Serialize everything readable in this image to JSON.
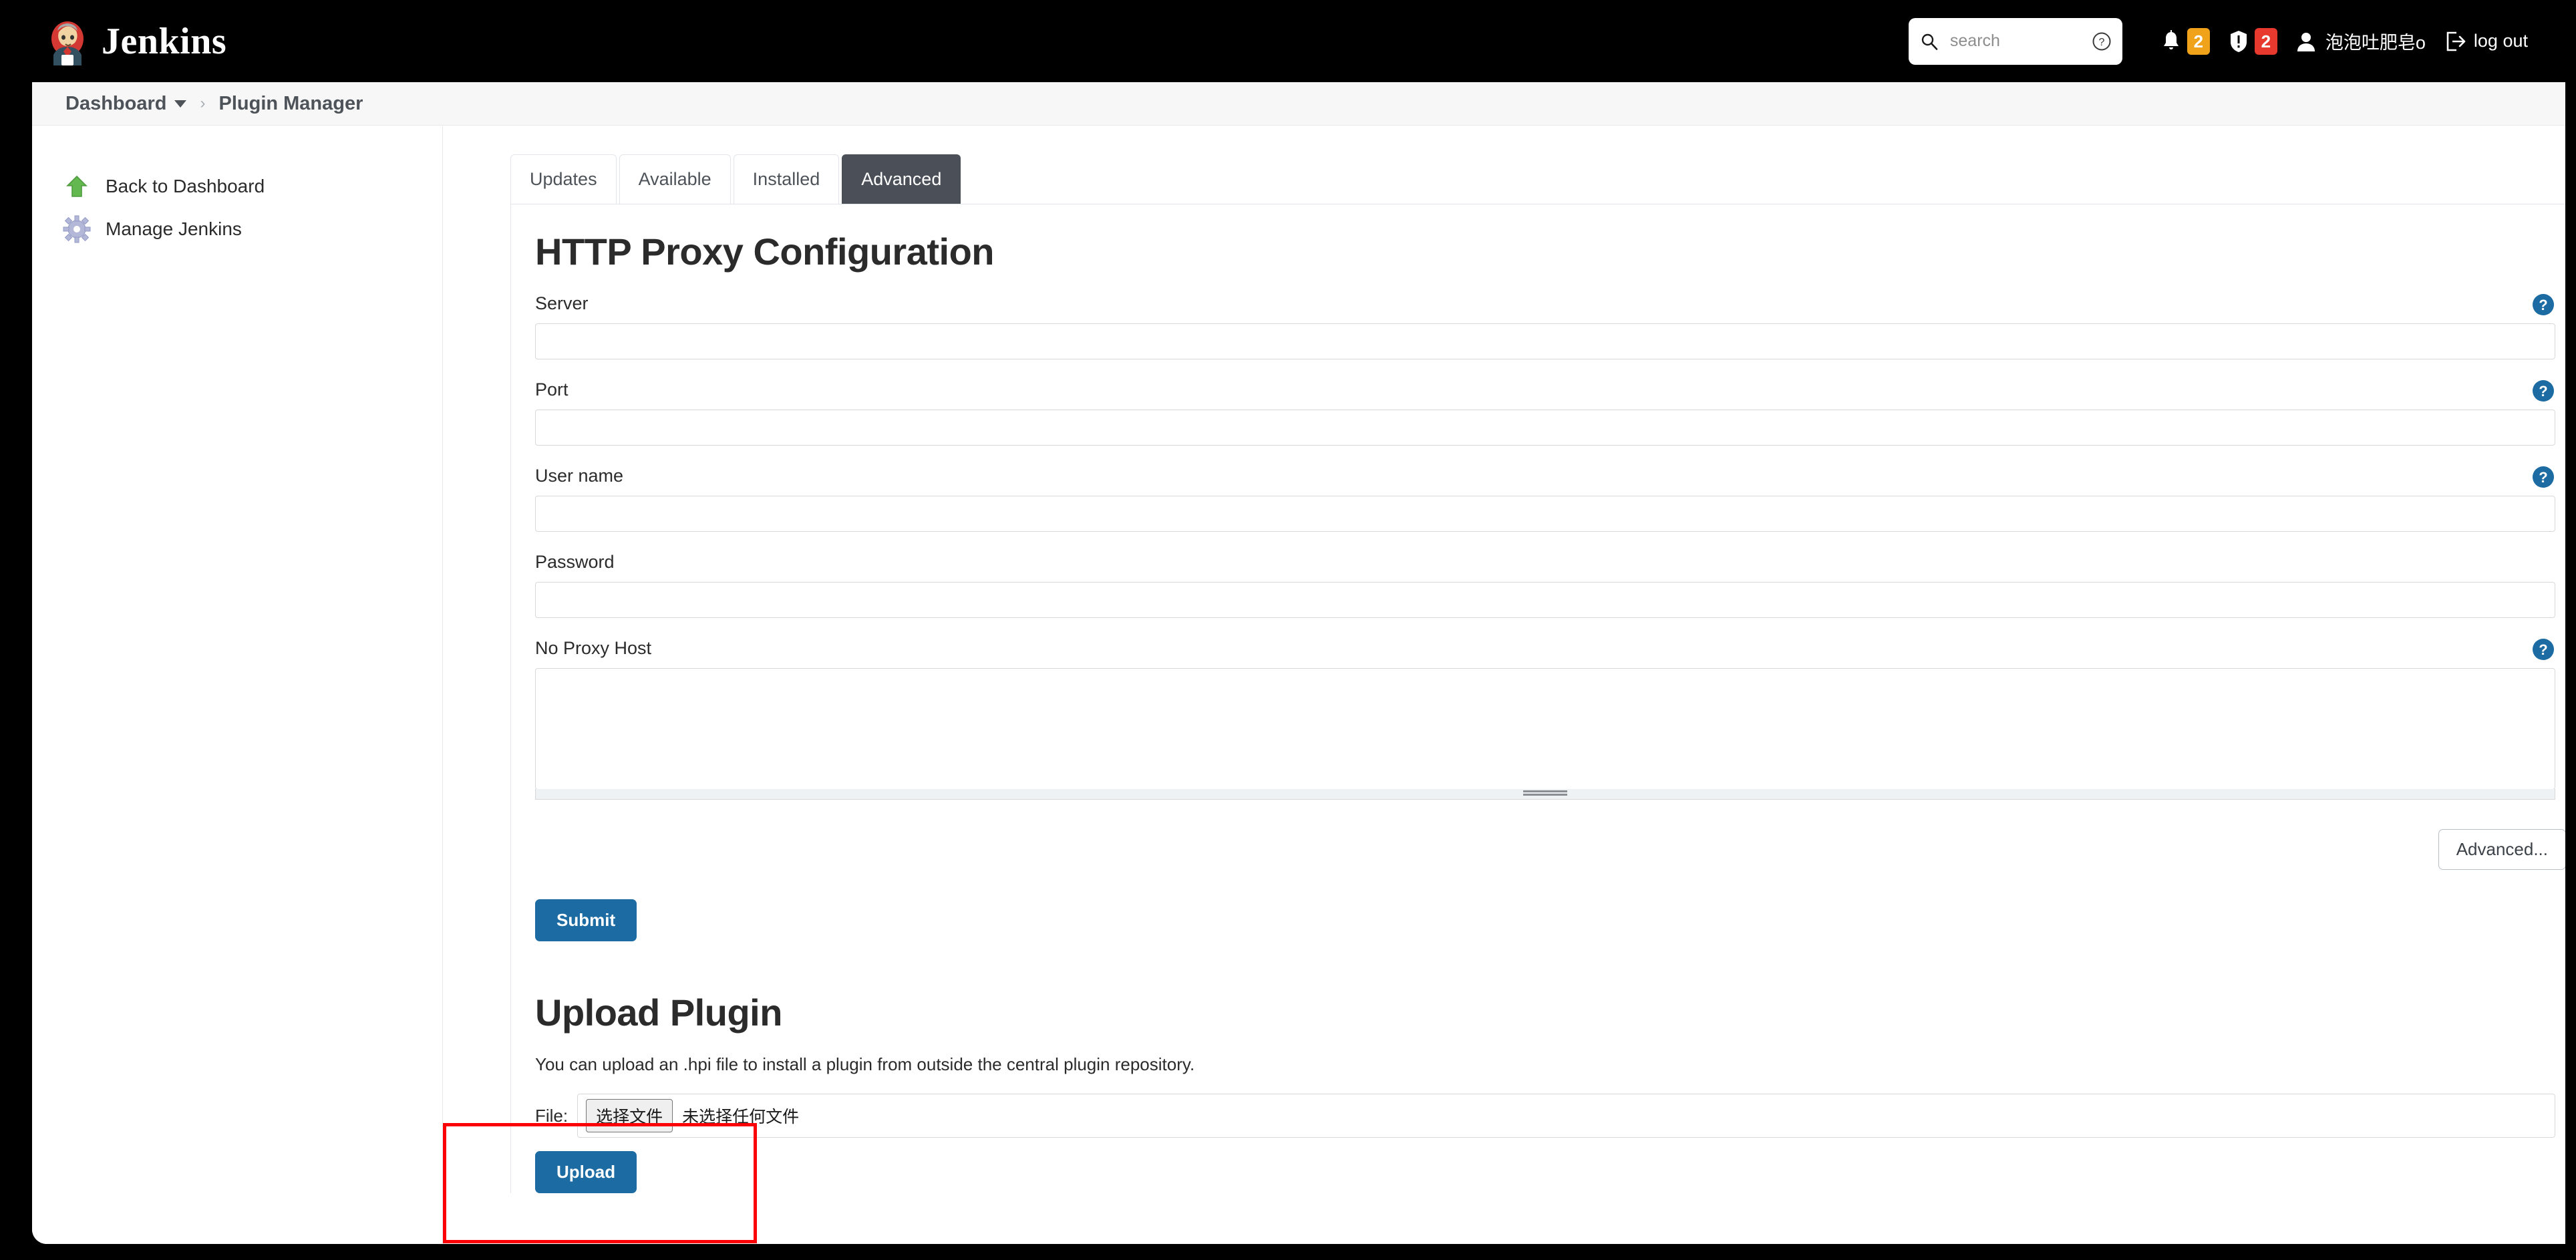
{
  "header": {
    "brand_title": "Jenkins",
    "logo_icon": "jenkins-butler-logo",
    "search": {
      "placeholder": "search",
      "value": "",
      "search_icon": "search-icon",
      "help_icon": "help-circle-icon"
    },
    "notifications": {
      "icon": "bell-icon",
      "count": "2",
      "badge_color": "#f0a31a"
    },
    "alerts": {
      "icon": "security-warning-icon",
      "count": "2",
      "badge_color": "#e8392f"
    },
    "user": {
      "icon": "person-icon",
      "name": "泡泡吐肥皂o"
    },
    "logout": {
      "icon": "logout-icon",
      "label": "log out"
    }
  },
  "breadcrumb": {
    "items": [
      {
        "label": "Dashboard",
        "has_caret": true
      },
      {
        "label": "Plugin Manager",
        "has_caret": false
      }
    ],
    "separator": "›"
  },
  "sidebar": {
    "items": [
      {
        "label": "Back to Dashboard",
        "icon": "up-arrow-icon"
      },
      {
        "label": "Manage Jenkins",
        "icon": "gear-icon"
      }
    ]
  },
  "main": {
    "tabs": [
      {
        "label": "Updates",
        "active": false
      },
      {
        "label": "Available",
        "active": false
      },
      {
        "label": "Installed",
        "active": false
      },
      {
        "label": "Advanced",
        "active": true
      }
    ],
    "proxy": {
      "title": "HTTP Proxy Configuration",
      "fields": [
        {
          "label": "Server",
          "value": "",
          "type": "text",
          "help": true
        },
        {
          "label": "Port",
          "value": "",
          "type": "text",
          "help": true
        },
        {
          "label": "User name",
          "value": "",
          "type": "text",
          "help": true
        },
        {
          "label": "Password",
          "value": "",
          "type": "password",
          "help": false
        },
        {
          "label": "No Proxy Host",
          "value": "",
          "type": "textarea",
          "help": true
        }
      ],
      "advanced_button": "Advanced...",
      "submit_button": "Submit"
    },
    "upload": {
      "title": "Upload Plugin",
      "description": "You can upload an .hpi file to install a plugin from outside the central plugin repository.",
      "file_label": "File:",
      "choose_file_button": "选择文件",
      "no_file_text": "未选择任何文件",
      "upload_button": "Upload"
    }
  },
  "annotation": {
    "type": "highlight-rectangle",
    "color": "#fb0007"
  }
}
